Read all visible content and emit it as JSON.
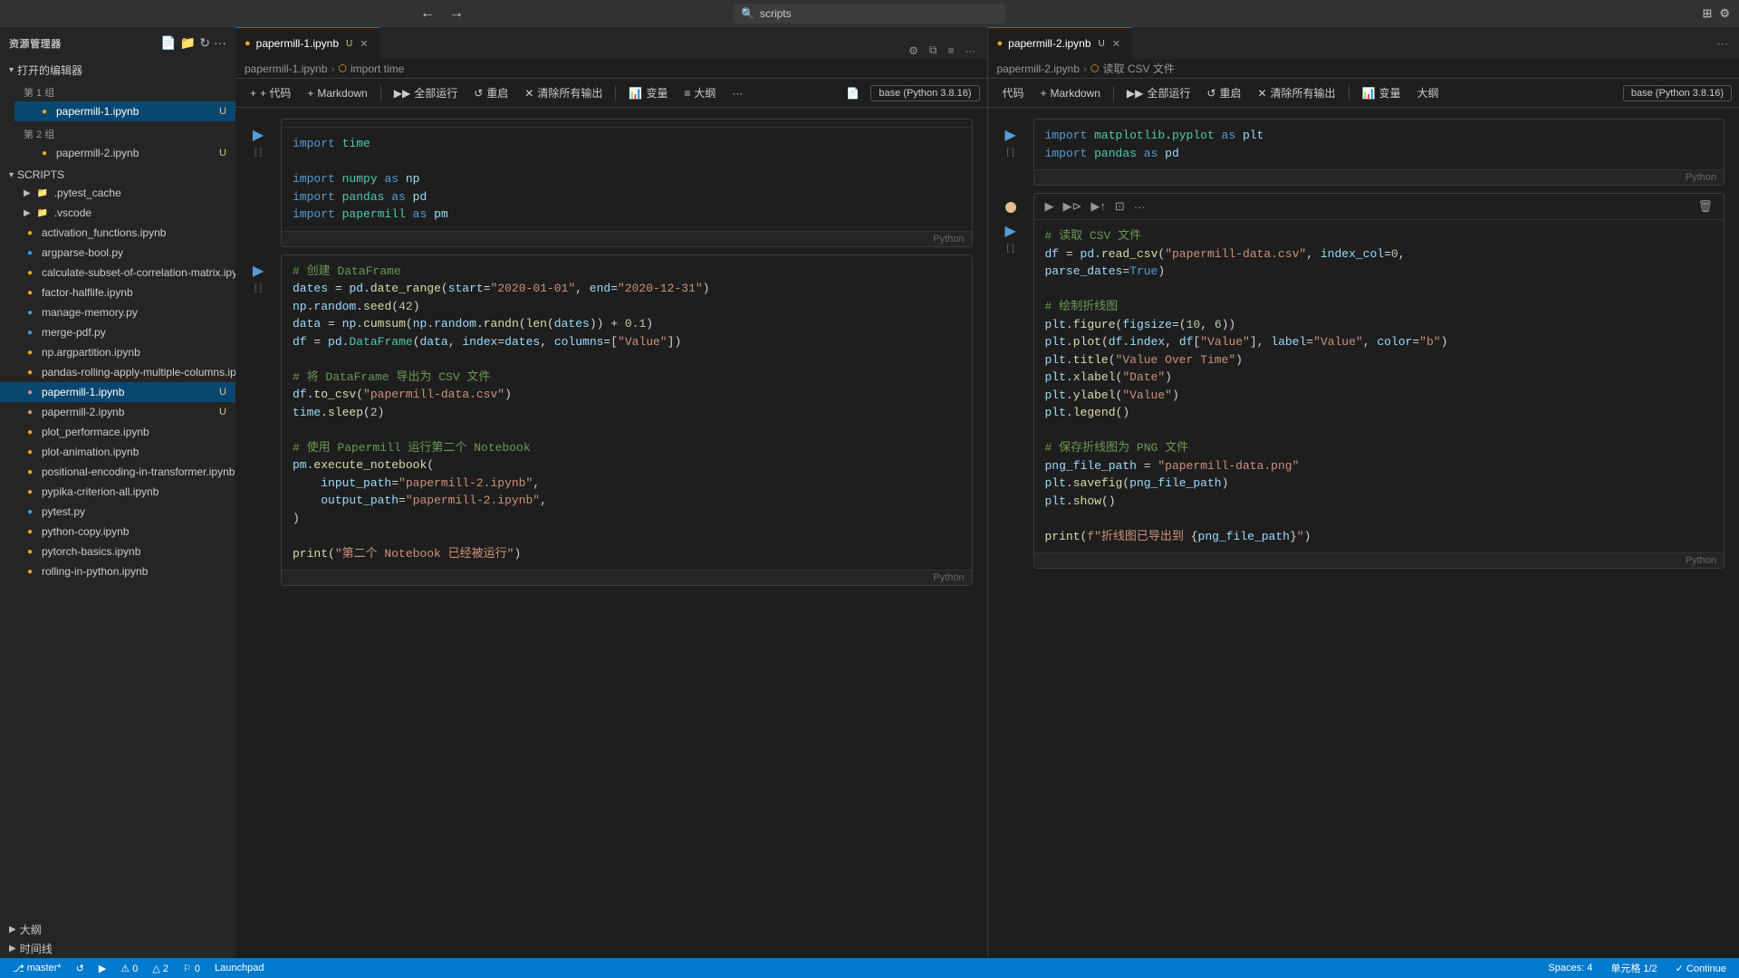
{
  "titlebar": {
    "search_placeholder": "scripts",
    "nav_back": "←",
    "nav_forward": "→"
  },
  "sidebar": {
    "title": "资源管理器",
    "more_label": "···",
    "open_editors_label": "打开的编辑器",
    "group1_label": "第 1 组",
    "group2_label": "第 2 组",
    "group1_files": [
      {
        "name": "papermill-1.ipynb",
        "type": "ipynb",
        "modified": "U",
        "active": true
      },
      {
        "name": "papermill-2.ipynb",
        "type": "ipynb",
        "modified": "U",
        "active": false
      }
    ],
    "scripts_label": "SCRIPTS",
    "scripts_items": [
      {
        "name": ".pytest_cache",
        "type": "folder"
      },
      {
        "name": ".vscode",
        "type": "folder"
      },
      {
        "name": "activation_functions.ipynb",
        "type": "ipynb"
      },
      {
        "name": "argparse-bool.py",
        "type": "py"
      },
      {
        "name": "calculate-subset-of-correlation-matrix.ipynb",
        "type": "ipynb"
      },
      {
        "name": "factor-halflife.ipynb",
        "type": "ipynb"
      },
      {
        "name": "manage-memory.py",
        "type": "py"
      },
      {
        "name": "merge-pdf.py",
        "type": "py"
      },
      {
        "name": "np.argpartition.ipynb",
        "type": "ipynb"
      },
      {
        "name": "pandas-rolling-apply-multiple-columns.ipynb",
        "type": "ipynb"
      },
      {
        "name": "papermill-1.ipynb",
        "type": "ipynb",
        "active": true
      },
      {
        "name": "papermill-2.ipynb",
        "type": "ipynb"
      },
      {
        "name": "plot_performace.ipynb",
        "type": "ipynb"
      },
      {
        "name": "plot-animation.ipynb",
        "type": "ipynb"
      },
      {
        "name": "positional-encoding-in-transformer.ipynb",
        "type": "ipynb"
      },
      {
        "name": "pypika-criterion-all.ipynb",
        "type": "ipynb"
      },
      {
        "name": "pytest.py",
        "type": "py"
      },
      {
        "name": "python-copy.ipynb",
        "type": "ipynb"
      },
      {
        "name": "pytorch-basics.ipynb",
        "type": "ipynb"
      },
      {
        "name": "rolling-in-python.ipynb",
        "type": "ipynb"
      }
    ],
    "outline_label": "大纲",
    "timeline_label": "时间线"
  },
  "pane1": {
    "tab_label": "papermill-1.ipynb",
    "tab_modified": "U",
    "breadcrumb_parts": [
      "papermill-1.ipynb",
      "import time"
    ],
    "toolbar": {
      "code_btn": "+ 代码",
      "markdown_btn": "Markdown",
      "run_all_btn": "全部运行",
      "restart_btn": "重启",
      "clear_all_btn": "清除所有输出",
      "variable_btn": "变量",
      "outline_btn": "大纲",
      "more_btn": "···",
      "kernel": "base (Python 3.8.16)"
    },
    "cell1": {
      "counter": "[ ]",
      "code_html": "import time\n\nimport numpy as np\nimport pandas as pd\nimport papermill as pm"
    },
    "cell2": {
      "counter": "[ ]",
      "code_lines": [
        "# 创建 DataFrame",
        "dates = pd.date_range(start=\"2020-01-01\", end=\"2020-12-31\")",
        "np.random.seed(42)",
        "data = np.cumsum(np.random.randn(len(dates)) + 0.1)",
        "df = pd.DataFrame(data, index=dates, columns=[\"Value\"])",
        "",
        "# 将 DataFrame 导出为 CSV 文件",
        "df.to_csv(\"papermill-data.csv\")",
        "time.sleep(2)",
        "",
        "# 使用 Papermill 运行第二个 Notebook",
        "pm.execute_notebook(",
        "    input_path=\"papermill-2.ipynb\",",
        "    output_path=\"papermill-2.ipynb\",",
        ")",
        "",
        "print(\"第二个 Notebook 已经被运行\")"
      ]
    }
  },
  "pane2": {
    "tab_label": "papermill-2.ipynb",
    "tab_modified": "U",
    "breadcrumb_parts": [
      "papermill-2.ipynb",
      "读取 CSV 文件"
    ],
    "toolbar": {
      "code_btn": "代码",
      "markdown_btn": "Markdown",
      "run_all_btn": "全部运行",
      "restart_btn": "重启",
      "clear_all_btn": "清除所有输出",
      "variable_btn": "变量",
      "outline_btn": "大纲",
      "kernel": "base (Python 3.8.16)"
    },
    "cell1": {
      "counter": "[ ]",
      "lines": [
        "import matplotlib.pyplot as plt",
        "import pandas as pd"
      ]
    },
    "cell2": {
      "counter": "[ ]",
      "section": "# 读取 CSV 文件",
      "lines": [
        "df = pd.read_csv(\"papermill-data.csv\", index_col=0,",
        "parse_dates=True)",
        "",
        "# 绘制折线图",
        "plt.figure(figsize=(10, 6))",
        "plt.plot(df.index, df[\"Value\"], label=\"Value\", color=\"b\")",
        "plt.title(\"Value Over Time\")",
        "plt.xlabel(\"Date\")",
        "plt.ylabel(\"Value\")",
        "plt.legend()",
        "",
        "# 保存折线图为 PNG 文件",
        "png_file_path = \"papermill-data.png\"",
        "plt.savefig(png_file_path)",
        "plt.show()",
        "",
        "print(f\"折线图已导出到 {png_file_path}\")"
      ]
    }
  },
  "statusbar": {
    "branch": "master*",
    "sync": "",
    "errors": "⚠ 0",
    "warnings": "△ 2",
    "issues": "⚐ 0",
    "launchpad": "Launchpad",
    "spaces": "Spaces: 4",
    "cell_info": "单元格 1/2",
    "encoding": "",
    "continue": "✓ Continue"
  }
}
